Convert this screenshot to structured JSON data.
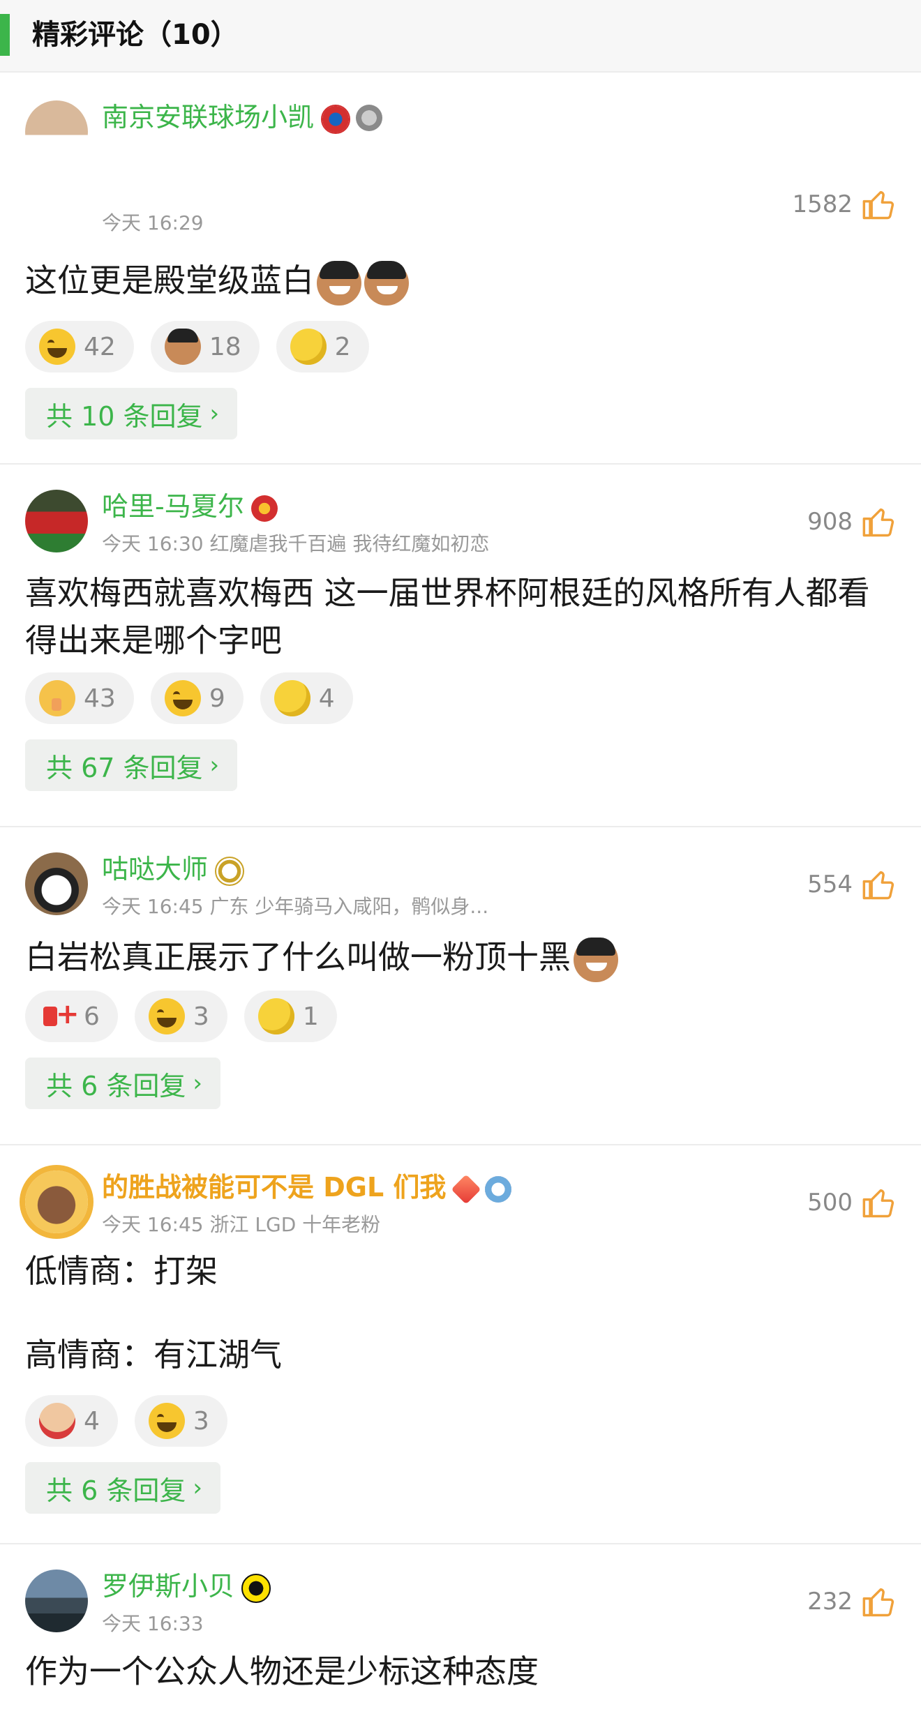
{
  "section": {
    "title": "精彩评论（10）"
  },
  "comments": [
    {
      "username": "南京安联球场小凯",
      "meta": "今天 16:29",
      "likes": "1582",
      "lines": [
        "这位更是殿堂级蓝白"
      ],
      "reactions": [
        {
          "emoji": "laugh-cry-icon",
          "count": "42"
        },
        {
          "emoji": "cap-face-icon",
          "count": "18"
        },
        {
          "emoji": "lemon-icon",
          "count": "2"
        }
      ],
      "replies": "共 10 条回复"
    },
    {
      "username": "哈里-马夏尔",
      "meta": "今天 16:30 红魔虐我千百遍 我待红魔如初恋",
      "likes": "908",
      "lines": [
        "喜欢梅西就喜欢梅西 这一届世界杯阿根廷的风格所有人都看得出来是哪个字吧"
      ],
      "reactions": [
        {
          "emoji": "shush-icon",
          "count": "43"
        },
        {
          "emoji": "laugh-cry-icon",
          "count": "9"
        },
        {
          "emoji": "lemon-icon",
          "count": "4"
        }
      ],
      "replies": "共 67 条回复"
    },
    {
      "username": "咕哒大师",
      "meta": "今天 16:45 广东 少年骑马入咸阳，鹘似身...",
      "likes": "554",
      "lines": [
        "白岩松真正展示了什么叫做一粉顶十黑"
      ],
      "reactions": [
        {
          "emoji": "plus-one-icon",
          "count": "6"
        },
        {
          "emoji": "laugh-cry-icon",
          "count": "3"
        },
        {
          "emoji": "lemon-icon",
          "count": "1"
        }
      ],
      "replies": "共 6 条回复"
    },
    {
      "username": "的胜战被能可不是 DGL 们我",
      "meta": "今天 16:45 浙江 LGD 十年老粉",
      "likes": "500",
      "lines": [
        "低情商：打架",
        "高情商：有江湖气"
      ],
      "reactions": [
        {
          "emoji": "facepalm-cartoon-icon",
          "count": "4"
        },
        {
          "emoji": "laugh-cry-icon",
          "count": "3"
        }
      ],
      "replies": "共 6 条回复"
    },
    {
      "username": "罗伊斯小贝",
      "meta": "今天 16:33",
      "likes": "232",
      "lines": [
        "作为一个公众人物还是少标这种态度"
      ]
    }
  ],
  "colors": {
    "accent": "#3cb54a",
    "gold": "#eea31d",
    "like": "#f0a13a"
  }
}
